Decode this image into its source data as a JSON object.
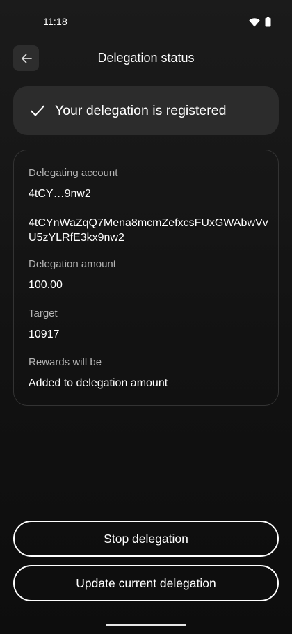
{
  "status_bar": {
    "time": "11:18",
    "icons": [
      "wifi-icon",
      "battery-icon"
    ]
  },
  "header": {
    "title": "Delegation status",
    "back_icon": "arrow-left-icon"
  },
  "banner": {
    "icon": "checkmark-icon",
    "text": "Your delegation is registered"
  },
  "details": {
    "delegating_account_label": "Delegating account",
    "account_short": "4tCY…9nw2",
    "account_full": "4tCYnWaZqQ7Mena8mcmZefxcsFUxGWAbwVvU5zYLRfE3kx9nw2",
    "amount_label": "Delegation amount",
    "amount_value": "100.00",
    "target_label": "Target",
    "target_value": "10917",
    "rewards_label": "Rewards will be",
    "rewards_value": "Added to delegation amount"
  },
  "actions": {
    "stop_label": "Stop delegation",
    "update_label": "Update current delegation"
  },
  "colors": {
    "background": "#151515",
    "banner": "#2c2c2c",
    "card_border": "#333333",
    "label": "#b4b4b4",
    "text": "#ffffff"
  }
}
